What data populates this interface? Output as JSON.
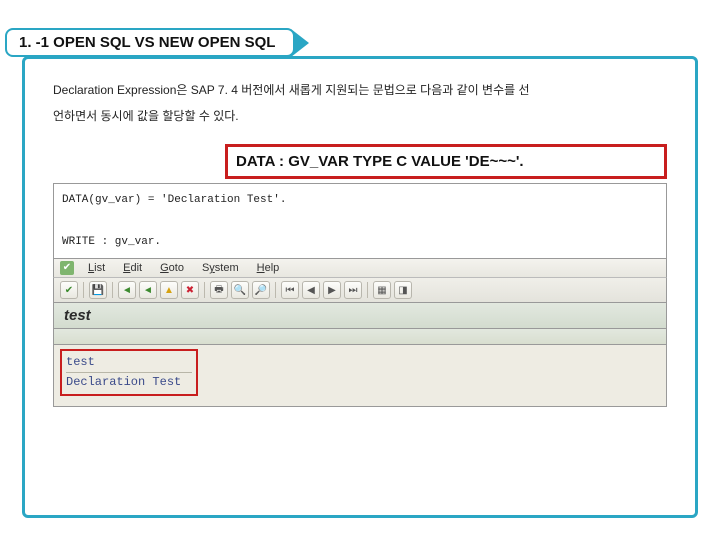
{
  "ribbon": {
    "title": "1. -1 OPEN SQL VS NEW OPEN SQL"
  },
  "description": {
    "line1": "Declaration Expression은 SAP 7. 4 버전에서 새롭게 지원되는 문법으로 다음과 같이 변수를 선",
    "line2": "언하면서 동시에 값을 할당할 수 있다."
  },
  "highlight": {
    "text": "DATA : GV_VAR TYPE C VALUE 'DE~~~'."
  },
  "code": {
    "line1": "DATA(gv_var) = 'Declaration Test'.",
    "line2": "WRITE : gv_var."
  },
  "menu": {
    "items": [
      "List",
      "Edit",
      "Goto",
      "System",
      "Help"
    ]
  },
  "toolbar": {
    "icons": [
      "check",
      "disk",
      "back",
      "back2",
      "cancel",
      "close",
      "print",
      "find",
      "findnext",
      "first",
      "prev",
      "next",
      "last",
      "layout",
      "graphic"
    ]
  },
  "section": {
    "title": "test"
  },
  "output": {
    "rows": [
      "test",
      "Declaration Test"
    ]
  }
}
